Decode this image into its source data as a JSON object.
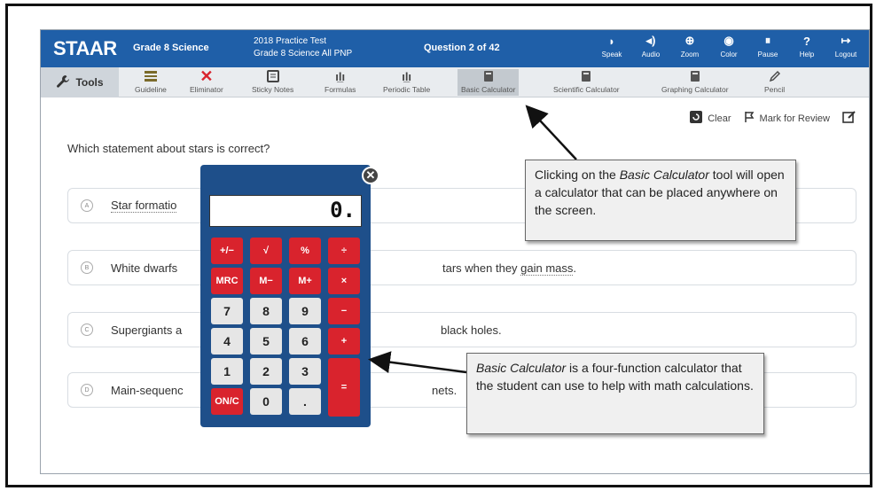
{
  "header": {
    "brand": "STAAR",
    "grade": "Grade 8 Science",
    "test_line1": "2018 Practice Test",
    "test_line2": "Grade 8 Science All PNP",
    "question": "Question 2 of 42",
    "tools": [
      {
        "label": "Speak",
        "icon": "speak-icon",
        "glyph": "◗"
      },
      {
        "label": "Audio",
        "icon": "audio-icon",
        "glyph": "◂)"
      },
      {
        "label": "Zoom",
        "icon": "zoom-icon",
        "glyph": "⊕"
      },
      {
        "label": "Color",
        "icon": "color-icon",
        "glyph": "◉"
      },
      {
        "label": "Pause",
        "icon": "pause-icon",
        "glyph": "⏸"
      },
      {
        "label": "Help",
        "icon": "help-icon",
        "glyph": "?"
      },
      {
        "label": "Logout",
        "icon": "logout-icon",
        "glyph": "↦"
      }
    ]
  },
  "toolbar": {
    "tools_label": "Tools",
    "items": [
      {
        "label": "Guideline",
        "icon": "guideline-icon"
      },
      {
        "label": "Eliminator",
        "icon": "eliminator-icon"
      },
      {
        "label": "Sticky Notes",
        "icon": "sticky-notes-icon"
      },
      {
        "label": "Formulas",
        "icon": "formulas-icon"
      },
      {
        "label": "Periodic Table",
        "icon": "periodic-table-icon"
      },
      {
        "label": "Basic Calculator",
        "icon": "basic-calculator-icon"
      },
      {
        "label": "Scientific Calculator",
        "icon": "scientific-calculator-icon"
      },
      {
        "label": "Graphing Calculator",
        "icon": "graphing-calculator-icon"
      },
      {
        "label": "Pencil",
        "icon": "pencil-icon"
      }
    ]
  },
  "actions": {
    "clear": "Clear",
    "mark": "Mark for Review"
  },
  "question": {
    "text": "Which statement about stars is correct?",
    "options": [
      {
        "letter": "A",
        "text": "Star formatio"
      },
      {
        "letter": "B",
        "prefix": "White dwarfs",
        "suffix": "tars when they ",
        "underlined": "gain mass",
        "end": "."
      },
      {
        "letter": "C",
        "prefix": "Supergiants a",
        "suffix": "black holes."
      },
      {
        "letter": "D",
        "prefix": "Main-sequenc",
        "suffix": "nets."
      }
    ]
  },
  "calculator": {
    "display": "0.",
    "keys": [
      "+/−",
      "√",
      "%",
      "÷",
      "MRC",
      "M−",
      "M+",
      "×",
      "7",
      "8",
      "9",
      "−",
      "4",
      "5",
      "6",
      "+",
      "1",
      "2",
      "3",
      "=",
      "ON/C",
      "0",
      "."
    ],
    "close": "✕"
  },
  "callouts": {
    "top_lead": "Clicking on the ",
    "top_em": "Basic Calculator",
    "top_rest": " tool will open a calculator that can be placed anywhere on the screen.",
    "bottom_em": "Basic Calculator",
    "bottom_rest": " is a four-function calculator that the student can use to help with math calculations."
  }
}
